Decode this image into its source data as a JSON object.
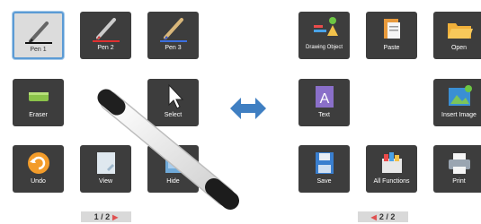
{
  "left_panel": {
    "tiles": [
      {
        "label": "Pen 1",
        "icon": "pen-black-icon",
        "selected": true
      },
      {
        "label": "Pen 2",
        "icon": "pen-red-icon"
      },
      {
        "label": "Pen 3",
        "icon": "pen-blue-icon"
      },
      {
        "label": "Eraser",
        "icon": "eraser-icon"
      },
      {
        "label": "Select",
        "icon": "cursor-arrow-icon"
      },
      {
        "label": "Undo",
        "icon": "undo-icon"
      },
      {
        "label": "View",
        "icon": "view-icon"
      },
      {
        "label": "Hide",
        "icon": "hide-icon"
      }
    ],
    "pager": "1 / 2"
  },
  "right_panel": {
    "tiles": [
      {
        "label": "Drawing Object",
        "icon": "drawing-object-icon"
      },
      {
        "label": "Paste",
        "icon": "paste-icon"
      },
      {
        "label": "Open",
        "icon": "folder-open-icon"
      },
      {
        "label": "Text",
        "icon": "text-icon"
      },
      {
        "label": "Insert Image",
        "icon": "insert-image-icon"
      },
      {
        "label": "Save",
        "icon": "save-icon"
      },
      {
        "label": "All Functions",
        "icon": "all-functions-icon"
      },
      {
        "label": "Print",
        "icon": "print-icon"
      }
    ],
    "pager": "2 / 2"
  },
  "colors": {
    "tile": "#3d3d3d",
    "selected_border": "#5b9bd5",
    "swap_arrow": "#3f7fc2",
    "pager_arrow": "#e05050"
  }
}
